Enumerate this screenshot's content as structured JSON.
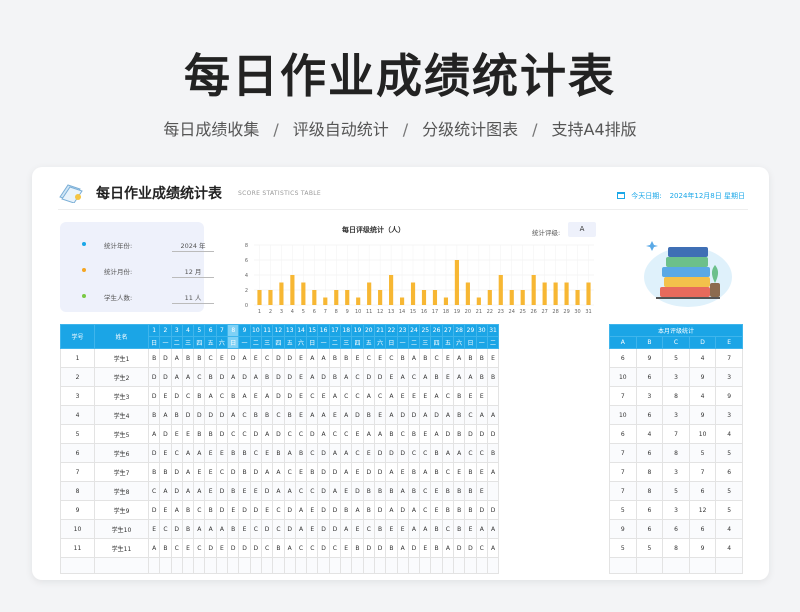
{
  "hero": {
    "title": "每日作业成绩统计表",
    "features": [
      "每日成绩收集",
      "评级自动统计",
      "分级统计图表",
      "支持A4排版"
    ],
    "separator": "/"
  },
  "card": {
    "title": "每日作业成绩统计表",
    "subtitle": "SCORE STATISTICS TABLE",
    "today_label": "今天日期:",
    "today_date": "2024年12月8日",
    "today_weekday": "星期日"
  },
  "info": [
    {
      "label": "统计年份:",
      "value": "2024 年",
      "color": "#1aa7e8"
    },
    {
      "label": "统计月份:",
      "value": "12 月",
      "color": "#f5a623"
    },
    {
      "label": "学生人数:",
      "value": "11 人",
      "color": "#7ac943"
    }
  ],
  "chart_data": {
    "type": "bar",
    "title": "每日评级统计（人）",
    "categories": [
      "1",
      "2",
      "3",
      "4",
      "5",
      "6",
      "7",
      "8",
      "9",
      "10",
      "11",
      "12",
      "13",
      "14",
      "15",
      "16",
      "17",
      "18",
      "19",
      "20",
      "21",
      "22",
      "23",
      "24",
      "25",
      "26",
      "27",
      "28",
      "29",
      "30",
      "31"
    ],
    "values": [
      2,
      2,
      3,
      4,
      3,
      2,
      1,
      2,
      2,
      1,
      3,
      2,
      4,
      1,
      3,
      2,
      2,
      1,
      6,
      3,
      1,
      2,
      4,
      2,
      2,
      4,
      3,
      3,
      3,
      2,
      3
    ],
    "ylim": [
      0,
      8
    ],
    "yticks": [
      0,
      2,
      4,
      6,
      8
    ],
    "grid": true,
    "bar_color": "#f7b733"
  },
  "level_filter": {
    "label": "统计评级:",
    "value": "A"
  },
  "table": {
    "col_id": "学号",
    "col_name": "姓名",
    "days": [
      "1",
      "2",
      "3",
      "4",
      "5",
      "6",
      "7",
      "8",
      "9",
      "10",
      "11",
      "12",
      "13",
      "14",
      "15",
      "16",
      "17",
      "18",
      "19",
      "20",
      "21",
      "22",
      "23",
      "24",
      "25",
      "26",
      "27",
      "28",
      "29",
      "30",
      "31"
    ],
    "weekdays": [
      "日",
      "一",
      "二",
      "三",
      "四",
      "五",
      "六",
      "日",
      "一",
      "二",
      "三",
      "四",
      "五",
      "六",
      "日",
      "一",
      "二",
      "三",
      "四",
      "五",
      "六",
      "日",
      "一",
      "二",
      "三",
      "四",
      "五",
      "六",
      "日",
      "一",
      "二"
    ],
    "current_day_index": 7,
    "rows": [
      {
        "id": "1",
        "name": "学生1",
        "grades": "BDABBCEDAECDDEAABBECECBABCEABBE"
      },
      {
        "id": "2",
        "name": "学生2",
        "grades": "DDAACBDADABDDEADBACDDEACABEAABB"
      },
      {
        "id": "3",
        "name": "学生3",
        "grades": "DEDCBACBAEADDECEACCACAEEEACBEE"
      },
      {
        "id": "4",
        "name": "学生4",
        "grades": "BABDDDDACBBCBEAAEADBEADDADABCAAA"
      },
      {
        "id": "5",
        "name": "学生5",
        "grades": "ADEEBBDCCDADCCDACCEAABCBEADBDDD"
      },
      {
        "id": "6",
        "name": "学生6",
        "grades": "DECAAEEBBCEBABCDAACEDDDCCBAACCB"
      },
      {
        "id": "7",
        "name": "学生7",
        "grades": "BBDAEECDBDAACEBDDAEDDAEBABCEBEA"
      },
      {
        "id": "8",
        "name": "学生8",
        "grades": "CADAAEDBEEDAACCDAEDBBBABCEBBBE"
      },
      {
        "id": "9",
        "name": "学生9",
        "grades": "DEABCBDEDDECDAEDDBABDADACEBBBDD"
      },
      {
        "id": "10",
        "name": "学生10",
        "grades": "ECDBAAABECDCDAEDDAECBEEAABCBEAA"
      },
      {
        "id": "11",
        "name": "学生11",
        "grades": "ABCECDEDDDCBACCDCEBDDBADEBADDCA"
      }
    ],
    "empty_rows": 1
  },
  "stats": {
    "title": "本月评级统计",
    "levels": [
      "A",
      "B",
      "C",
      "D",
      "E"
    ],
    "rows": [
      [
        "6",
        "9",
        "5",
        "4",
        "7"
      ],
      [
        "10",
        "6",
        "3",
        "9",
        "3"
      ],
      [
        "7",
        "3",
        "8",
        "4",
        "9"
      ],
      [
        "10",
        "6",
        "3",
        "9",
        "3"
      ],
      [
        "6",
        "4",
        "7",
        "10",
        "4"
      ],
      [
        "7",
        "6",
        "8",
        "5",
        "5"
      ],
      [
        "7",
        "8",
        "3",
        "7",
        "6"
      ],
      [
        "7",
        "8",
        "5",
        "6",
        "5"
      ],
      [
        "5",
        "6",
        "3",
        "12",
        "5"
      ],
      [
        "9",
        "6",
        "6",
        "6",
        "4"
      ],
      [
        "5",
        "5",
        "8",
        "9",
        "4"
      ]
    ]
  }
}
